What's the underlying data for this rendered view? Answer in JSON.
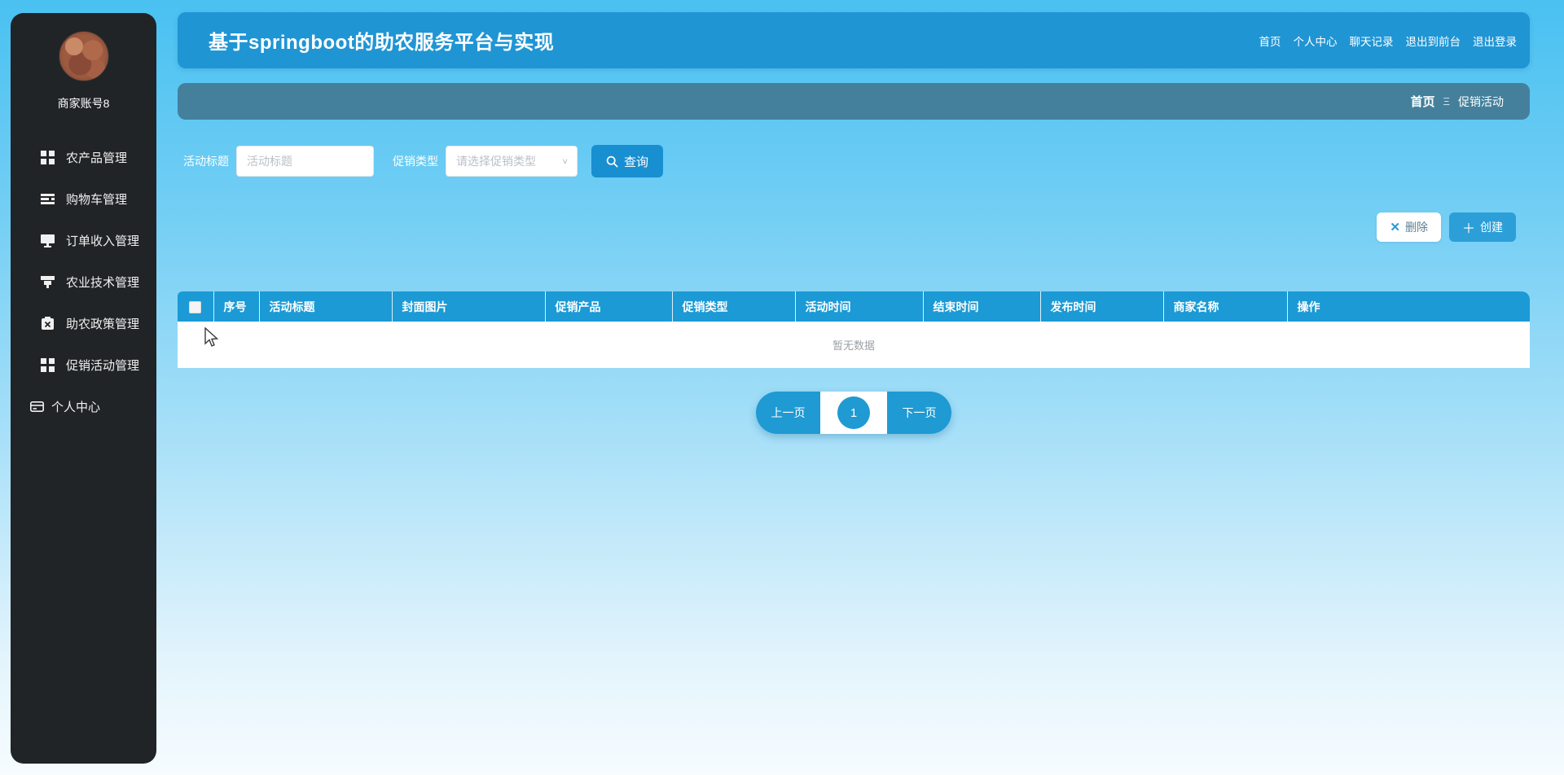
{
  "app": {
    "title": "基于springboot的助农服务平台与实现"
  },
  "topnav": {
    "items": [
      "首页",
      "个人中心",
      "聊天记录",
      "退出到前台",
      "退出登录"
    ]
  },
  "sidebar": {
    "username": "商家账号8",
    "items": [
      {
        "icon": "grid-icon",
        "label": "农产品管理"
      },
      {
        "icon": "list-icon",
        "label": "购物车管理"
      },
      {
        "icon": "monitor-icon",
        "label": "订单收入管理"
      },
      {
        "icon": "funnel-icon",
        "label": "农业技术管理"
      },
      {
        "icon": "clipboard-icon",
        "label": "助农政策管理"
      },
      {
        "icon": "grid-icon",
        "label": "促销活动管理"
      }
    ],
    "personal": {
      "icon": "card-icon",
      "label": "个人中心"
    }
  },
  "breadcrumb": {
    "home": "首页",
    "separator": "Ξ",
    "current": "促销活动"
  },
  "search": {
    "title_label": "活动标题",
    "title_placeholder": "活动标题",
    "title_value": "",
    "type_label": "促销类型",
    "type_placeholder": "请选择促销类型",
    "query_label": "查询"
  },
  "toolbar": {
    "delete_label": "删除",
    "create_label": "创建"
  },
  "table": {
    "headers": [
      "序号",
      "活动标题",
      "封面图片",
      "促销产品",
      "促销类型",
      "活动时间",
      "结束时间",
      "发布时间",
      "商家名称",
      "操作"
    ],
    "rows": [],
    "empty_text": "暂无数据"
  },
  "pagination": {
    "prev": "上一页",
    "page": "1",
    "next": "下一页"
  },
  "colors": {
    "header_blue": "#2095d4",
    "breadcrumb_teal": "#44809c",
    "table_header_blue": "#1b9ad5",
    "button_blue": "#2d9fd8",
    "query_blue": "#188fd0",
    "pagination_blue": "#1f9ad3",
    "sidebar_dark": "#212426",
    "bg_top": "#49c1f1",
    "bg_bottom": "#f6fcff"
  }
}
